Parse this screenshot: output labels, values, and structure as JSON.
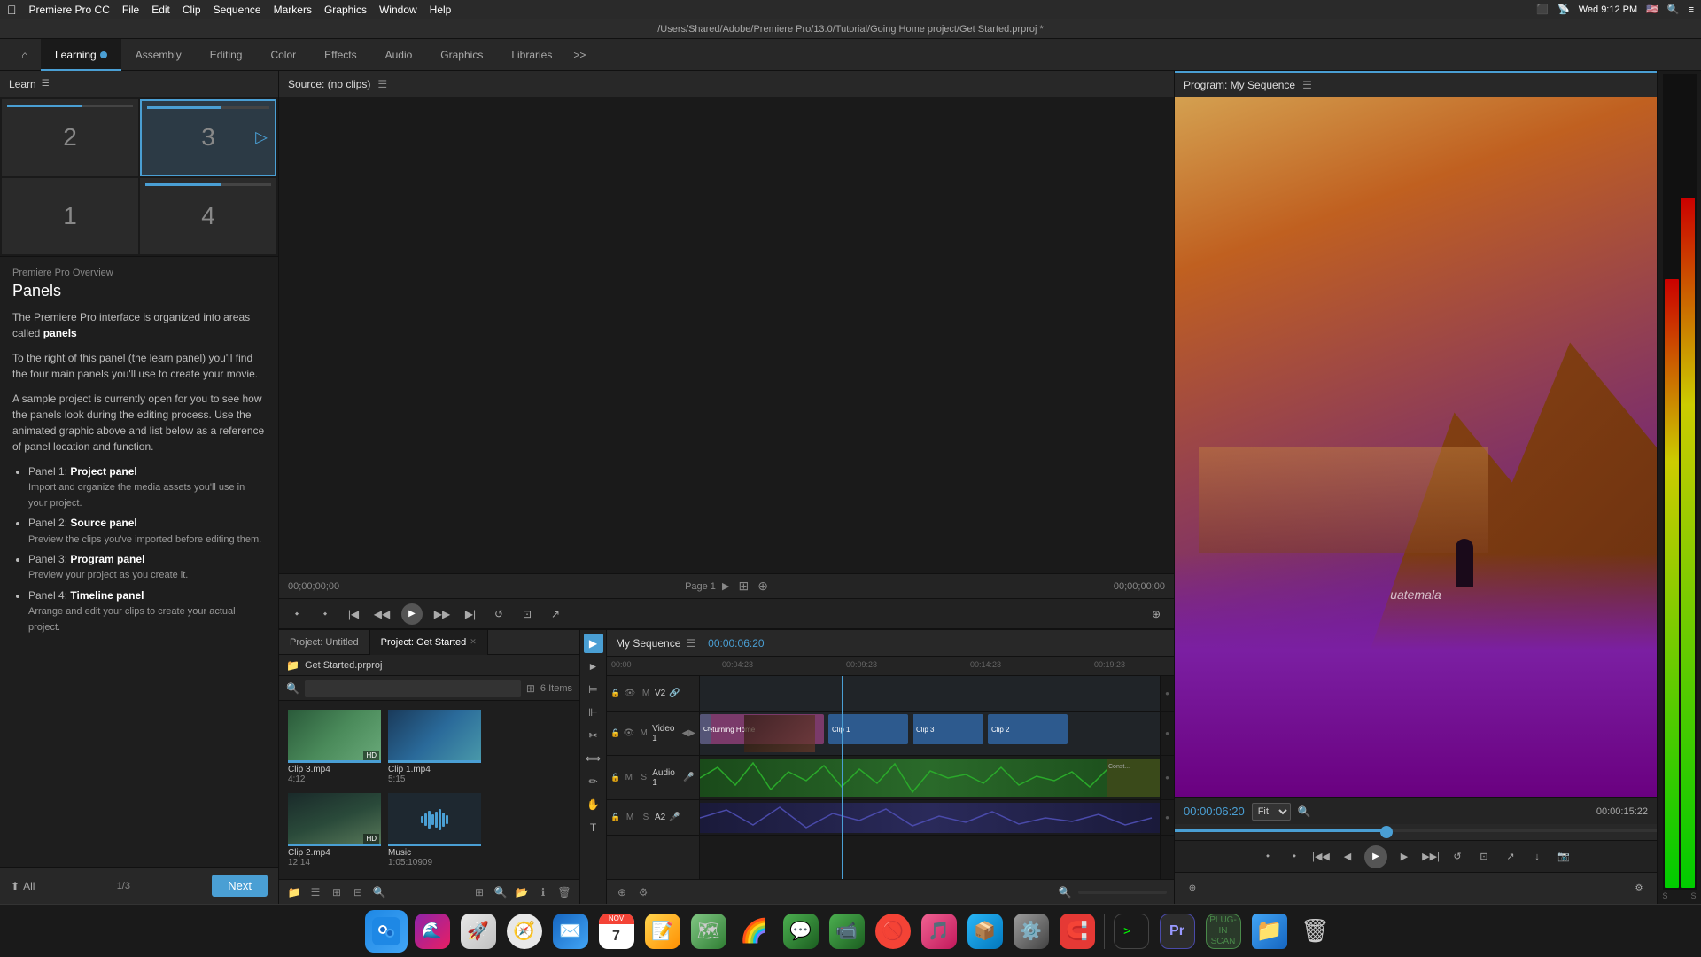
{
  "menubar": {
    "apple": "⌘",
    "items": [
      "Premiere Pro CC",
      "File",
      "Edit",
      "Clip",
      "Sequence",
      "Markers",
      "Graphics",
      "Window",
      "Help"
    ],
    "right": [
      "Wed 9:12 PM"
    ],
    "path": "/Users/Shared/Adobe/Premiere Pro/13.0/Tutorial/Going Home project/Get Started.prproj *"
  },
  "tabs": {
    "home_icon": "⌂",
    "items": [
      {
        "label": "Learning",
        "active": true
      },
      {
        "label": "Assembly",
        "active": false
      },
      {
        "label": "Editing",
        "active": false
      },
      {
        "label": "Color",
        "active": false
      },
      {
        "label": "Effects",
        "active": false
      },
      {
        "label": "Audio",
        "active": false
      },
      {
        "label": "Graphics",
        "active": false
      },
      {
        "label": "Libraries",
        "active": false
      }
    ],
    "more": ">>"
  },
  "learn_panel": {
    "header": "Learn",
    "thumbnails": [
      {
        "number": "2",
        "active": false,
        "has_bar": true
      },
      {
        "number": "3",
        "active": true,
        "has_bar": true,
        "has_play": true
      },
      {
        "number": "1",
        "active": false,
        "has_bar": false
      },
      {
        "number": "4",
        "active": false,
        "has_bar": true
      }
    ],
    "section_title": "Premiere Pro Overview",
    "title": "Panels",
    "paragraphs": [
      "The Premiere Pro interface is organized into areas called panels",
      "To the right of this panel (the learn panel) you'll find the four main panels you'll use to create your movie.",
      "A sample project is currently open for you to see how the panels look during the editing process. Use the animated graphic above and list below as a reference of panel location and function."
    ],
    "panels": [
      {
        "title": "Panel 1: Project panel",
        "desc": "Import and organize the media assets you'll use in your project."
      },
      {
        "title": "Panel 2: Source panel",
        "desc": "Preview the clips you've imported before editing them."
      },
      {
        "title": "Panel 3: Program panel",
        "desc": "Preview your project as you create it."
      },
      {
        "title": "Panel 4: Timeline panel",
        "desc": "Arrange and edit your clips to create your actual project."
      }
    ],
    "all_label": "All",
    "pagination": "1/3",
    "next_label": "Next"
  },
  "source_panel": {
    "header": "Source: (no clips)",
    "timecode_left": "00;00;00;00",
    "page": "Page 1",
    "timecode_right": "00;00;00;00"
  },
  "project_panel": {
    "tabs": [
      "Project: Untitled",
      "Project: Get Started"
    ],
    "active_tab": 1,
    "folder": "Get Started.prproj",
    "search_placeholder": "",
    "item_count": "6 Items",
    "clips": [
      {
        "name": "Clip 3.mp4",
        "duration": "4:12",
        "type": "video"
      },
      {
        "name": "Clip 1.mp4",
        "duration": "5:15",
        "type": "video"
      },
      {
        "name": "Clip 2.mp4",
        "duration": "12:14",
        "type": "video"
      },
      {
        "name": "Music",
        "duration": "1:05:10909",
        "type": "audio"
      }
    ]
  },
  "timeline_panel": {
    "header": "My Sequence",
    "timecode": "00:00:06:20",
    "timecodes_ruler": [
      "00:00",
      "00:04:23",
      "00:09:23",
      "00:14:23",
      "00:19:23"
    ],
    "tracks": [
      {
        "name": "V2",
        "type": "video"
      },
      {
        "name": "Video 1",
        "type": "video",
        "clips": [
          {
            "label": "Returning Home",
            "type": "returning"
          },
          {
            "label": "Clip 1",
            "type": "clip"
          },
          {
            "label": "Clip 3",
            "type": "clip"
          },
          {
            "label": "Clip 2",
            "type": "clip"
          }
        ]
      },
      {
        "name": "Audio 1",
        "type": "audio"
      },
      {
        "name": "A2",
        "type": "audio"
      }
    ]
  },
  "program_panel": {
    "header": "Program: My Sequence",
    "timecode": "00:00:06:20",
    "quality": "Fit",
    "timecode_right": "00:00:15:22",
    "video_text": "uatemala"
  },
  "dock": {
    "items": [
      {
        "icon": "🔵",
        "name": "finder",
        "color": "#1e88e5"
      },
      {
        "icon": "🟣",
        "name": "siri",
        "color": "#9c27b0"
      },
      {
        "icon": "🚀",
        "name": "launchpad"
      },
      {
        "icon": "🧭",
        "name": "safari"
      },
      {
        "icon": "📬",
        "name": "mail"
      },
      {
        "icon": "📅",
        "name": "calendar"
      },
      {
        "icon": "📝",
        "name": "notes"
      },
      {
        "icon": "🗺",
        "name": "maps"
      },
      {
        "icon": "🌈",
        "name": "photos"
      },
      {
        "icon": "💬",
        "name": "messages"
      },
      {
        "icon": "📱",
        "name": "facetime"
      },
      {
        "icon": "🚫",
        "name": "adguard"
      },
      {
        "icon": "🎵",
        "name": "music"
      },
      {
        "icon": "📦",
        "name": "appstore"
      },
      {
        "icon": "⚙️",
        "name": "system-prefs"
      },
      {
        "icon": "🔴",
        "name": "magnet"
      },
      {
        "icon": "💻",
        "name": "terminal"
      },
      {
        "icon": "🎬",
        "name": "premiere"
      },
      {
        "icon": "🟩",
        "name": "plug-in-scan"
      },
      {
        "icon": "📁",
        "name": "finder2"
      },
      {
        "icon": "🗑",
        "name": "trash"
      }
    ]
  }
}
